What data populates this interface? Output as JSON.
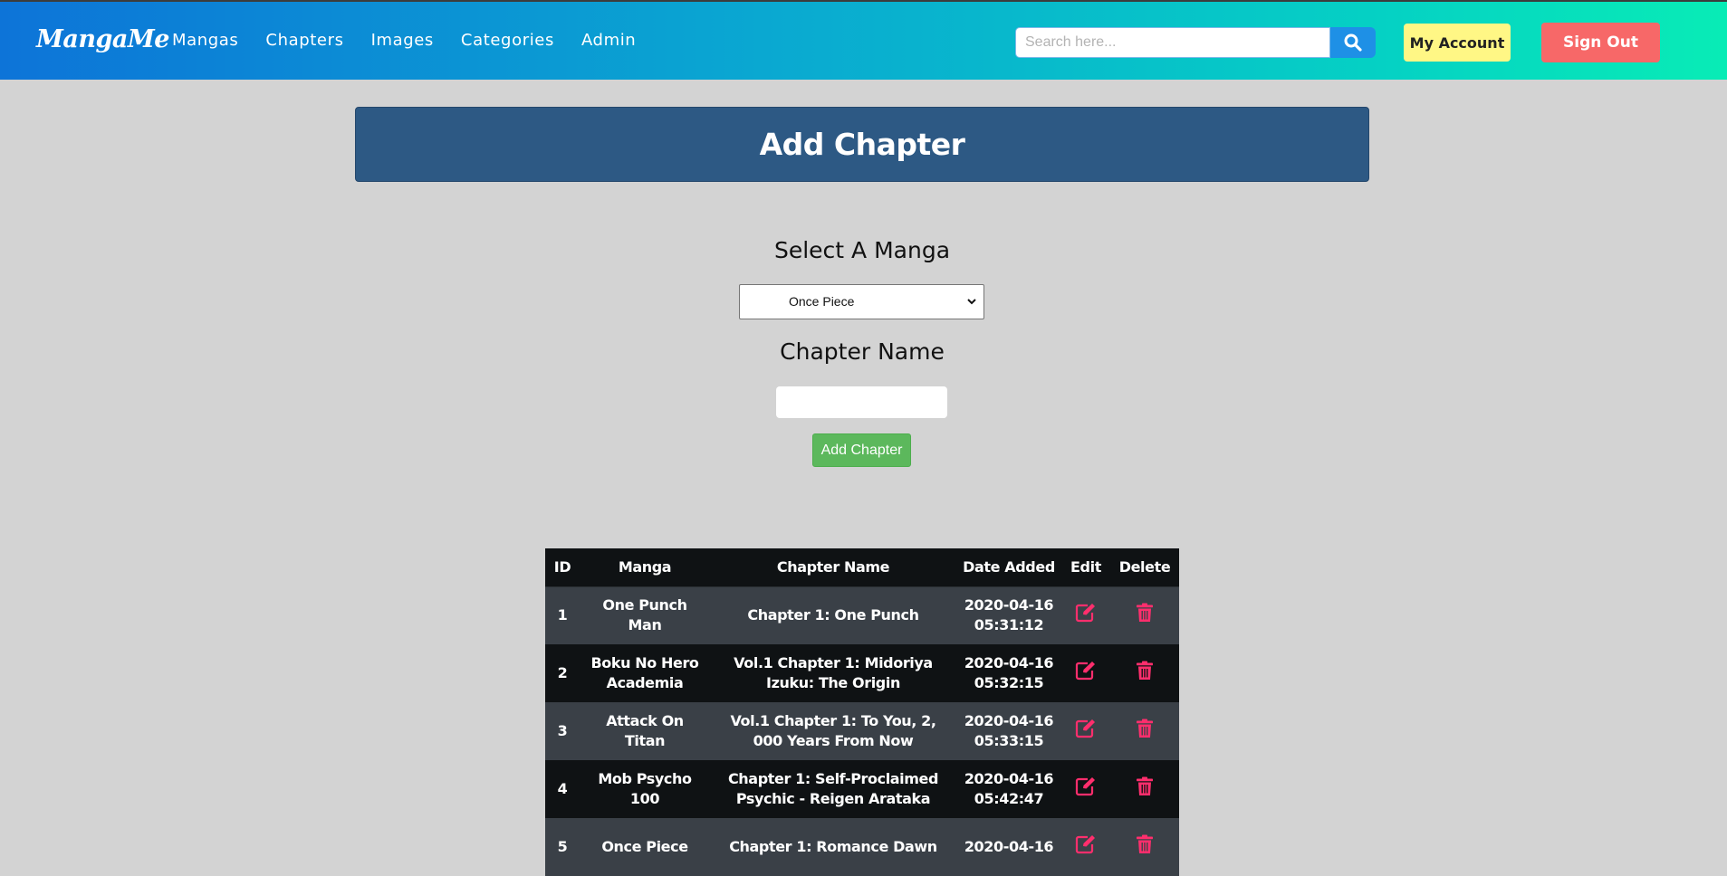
{
  "nav": {
    "brand": "MangaMe",
    "links": [
      "Mangas",
      "Chapters",
      "Images",
      "Categories",
      "Admin"
    ],
    "search_placeholder": "Search here...",
    "account_label": "My Account",
    "signout_label": "Sign Out"
  },
  "header": {
    "title": "Add Chapter"
  },
  "form": {
    "select_label": "Select A Manga",
    "selected_manga": "Once Piece",
    "chapter_label": "Chapter Name",
    "chapter_value": "",
    "submit_label": "Add Chapter"
  },
  "table": {
    "columns": [
      "ID",
      "Manga",
      "Chapter Name",
      "Date Added",
      "Edit",
      "Delete"
    ],
    "rows": [
      {
        "id": "1",
        "manga": "One Punch Man",
        "chapter": "Chapter 1: One Punch",
        "date": "2020-04-16",
        "time": "05:31:12"
      },
      {
        "id": "2",
        "manga": "Boku No Hero Academia",
        "chapter": "Vol.1 Chapter 1: Midoriya Izuku: The Origin",
        "date": "2020-04-16",
        "time": "05:32:15"
      },
      {
        "id": "3",
        "manga": "Attack On Titan",
        "chapter": "Vol.1 Chapter 1: To You, 2, 000 Years From Now",
        "date": "2020-04-16",
        "time": "05:33:15"
      },
      {
        "id": "4",
        "manga": "Mob Psycho 100",
        "chapter": "Chapter 1: Self-Proclaimed Psychic - Reigen Arataka",
        "date": "2020-04-16",
        "time": "05:42:47"
      },
      {
        "id": "5",
        "manga": "Once Piece",
        "chapter": "Chapter 1: Romance Dawn",
        "date": "2020-04-16",
        "time": ""
      }
    ]
  },
  "colors": {
    "accent_pink": "#ff2e6d",
    "header_blue": "#2d5984",
    "submit_green": "#5cb85c"
  }
}
